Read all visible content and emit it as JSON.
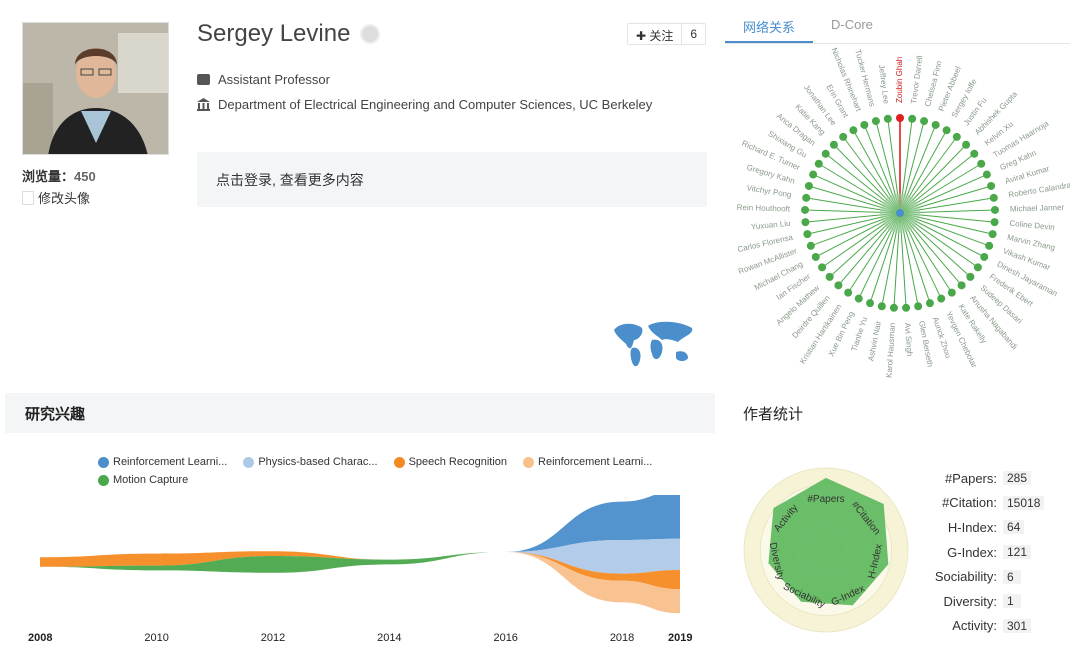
{
  "profile": {
    "name": "Sergey Levine",
    "views_label": "浏览量：",
    "views_count": "450",
    "edit_avatar": "修改头像",
    "position": "Assistant Professor",
    "affiliation": "Department of Electrical Engineering and Computer Sciences, UC Berkeley",
    "follow_label": "关注",
    "follow_count": "6",
    "login_prompt": "点击登录, 查看更多内容"
  },
  "tabs": [
    "网络关系",
    "D-Core"
  ],
  "graph": {
    "center_color": "#4aa84a",
    "highlight_color": "#e02020",
    "highlight_node": "Zoubin Ghahramani",
    "nodes": [
      "Zoubin Ghah",
      "Trevor Darrell",
      "Chelsea Finn",
      "Pieter Abbeel",
      "Sergey Ioffe",
      "Justin Fu",
      "Abhishek Gupta",
      "Kelvin Xu",
      "Tuomas Haarnoja",
      "Greg Kahn",
      "Aviral Kumar",
      "Roberto Calandra",
      "Michael Janner",
      "Coline Devin",
      "Marvin Zhang",
      "Vikash Kumar",
      "Dinesh Jayaraman",
      "Frederik Ebert",
      "Sudeep Dasari",
      "Anusha Nagabandi",
      "Kate Rakelly",
      "Yevgen Chebotar",
      "Aurick Zhou",
      "Glen Berseth",
      "Avi Singh",
      "Karol Hausman",
      "Ashvin Nair",
      "Tianhe Yu",
      "Xue Bin Peng",
      "Kristian Hartikainen",
      "Deirdre Quillen",
      "Angelo Mathew",
      "Ian Fischer",
      "Michael Chang",
      "Rowan McAllister",
      "Carlos Florensa",
      "Yuxuan Liu",
      "Rein Houthooft",
      "Vitchyr Pong",
      "Gregory Kahn",
      "Richard E. Turner",
      "Shixiang Gu",
      "Anca Dragan",
      "Katie Kang",
      "Jonathan Lee",
      "Erin Grant",
      "Nicholas Rhinehart",
      "Tucker Hermans",
      "Jeffrey Lee"
    ]
  },
  "interests": {
    "title": "研究兴趣",
    "colors": [
      "#4a8ecb",
      "#aec9e8",
      "#f58a22",
      "#f8c08b",
      "#4aa84a"
    ]
  },
  "chart_data": {
    "type": "area",
    "title": "",
    "x": [
      2008,
      2010,
      2012,
      2014,
      2016,
      2018,
      2019
    ],
    "x_tick_labels": [
      "2008",
      "2010",
      "2012",
      "2014",
      "2016",
      "2018",
      "2019"
    ],
    "series": [
      {
        "name": "Reinforcement Learni...",
        "values": [
          0,
          0,
          0,
          0,
          0,
          1.6,
          2.0
        ]
      },
      {
        "name": "Physics-based Charac...",
        "values": [
          0,
          0,
          0,
          0,
          0,
          1.4,
          1.3
        ]
      },
      {
        "name": "Speech Recognition",
        "values": [
          0.4,
          0.5,
          0.2,
          0,
          0,
          0.3,
          0.8
        ]
      },
      {
        "name": "Reinforcement Learni...",
        "values": [
          0,
          0,
          0,
          0,
          0,
          0.9,
          1.0
        ]
      },
      {
        "name": "Motion Capture",
        "values": [
          0,
          0.2,
          0.7,
          0.2,
          0,
          0,
          0
        ]
      }
    ],
    "grid": false
  },
  "stats": {
    "title": "作者统计",
    "rows": [
      {
        "label": "#Papers:",
        "value": "285"
      },
      {
        "label": "#Citation:",
        "value": "15018"
      },
      {
        "label": "H-Index:",
        "value": "64"
      },
      {
        "label": "G-Index:",
        "value": "121"
      },
      {
        "label": "Sociability:",
        "value": "6"
      },
      {
        "label": "Diversity:",
        "value": "1"
      },
      {
        "label": "Activity:",
        "value": "301"
      }
    ],
    "radar_axes": [
      "#Papers",
      "#Citation",
      "H-Index",
      "G-Index",
      "Sociability",
      "Diversity",
      "Activity"
    ],
    "radar_values": [
      0.88,
      0.9,
      0.78,
      0.75,
      0.7,
      0.72,
      0.82
    ],
    "radar_color": "#5cb85c"
  }
}
